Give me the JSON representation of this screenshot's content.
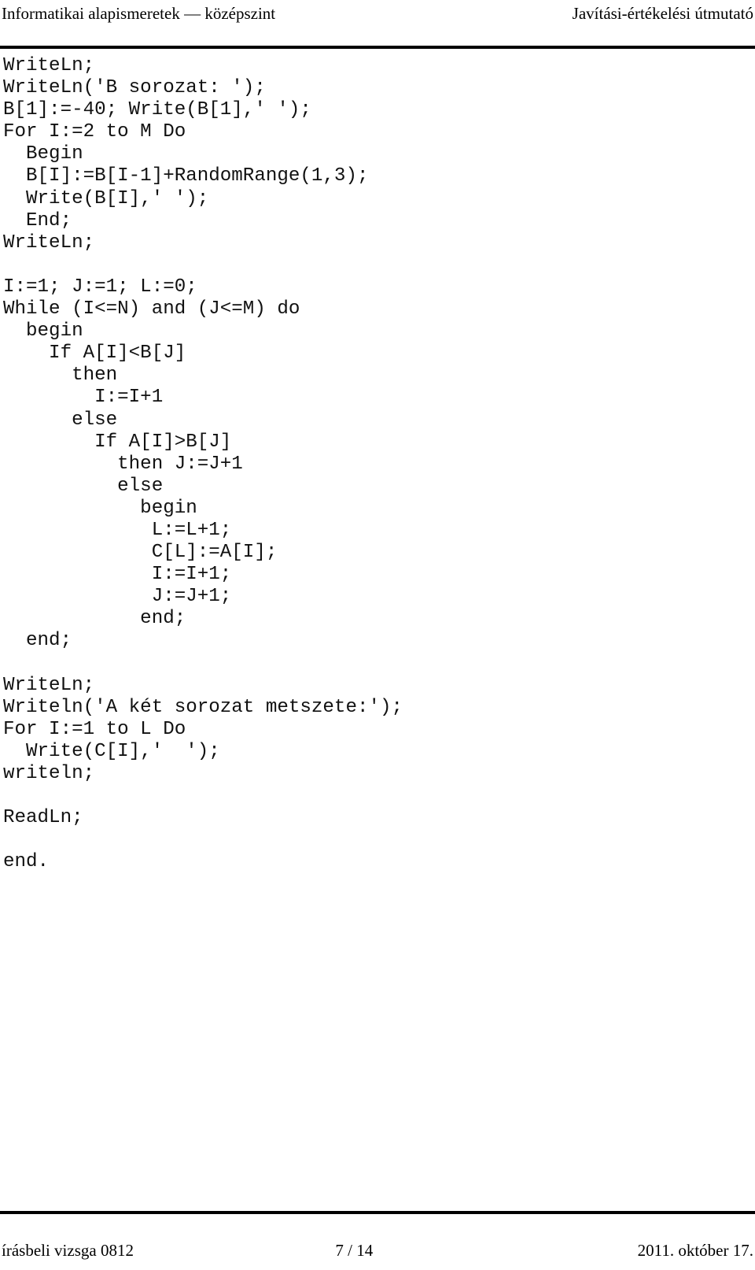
{
  "header": {
    "left": "Informatikai alapismeretek — középszint",
    "right": "Javítási-értékelési útmutató"
  },
  "code": {
    "language": "Pascal",
    "lines": [
      "WriteLn;",
      "WriteLn('B sorozat: ');",
      "B[1]:=-40; Write(B[1],' ');",
      "For I:=2 to M Do",
      "  Begin",
      "  B[I]:=B[I-1]+RandomRange(1,3);",
      "  Write(B[I],' ');",
      "  End;",
      "WriteLn;",
      "",
      "I:=1; J:=1; L:=0;",
      "While (I<=N) and (J<=M) do",
      "  begin",
      "    If A[I]<B[J]",
      "      then",
      "        I:=I+1",
      "      else",
      "        If A[I]>B[J]",
      "          then J:=J+1",
      "          else",
      "            begin",
      "             L:=L+1;",
      "             C[L]:=A[I];",
      "             I:=I+1;",
      "             J:=J+1;",
      "            end;",
      "  end;",
      "",
      "WriteLn;",
      "Writeln('A két sorozat metszete:');",
      "For I:=1 to L Do",
      "  Write(C[I],'  ');",
      "writeln;",
      "",
      "ReadLn;",
      "",
      "end."
    ]
  },
  "footer": {
    "left": "írásbeli vizsga 0812",
    "page": "7 / 14",
    "right": "2011. október 17."
  },
  "colors": {
    "text": "#000000",
    "code_text": "#111111",
    "rule": "#000000",
    "background": "#ffffff"
  }
}
